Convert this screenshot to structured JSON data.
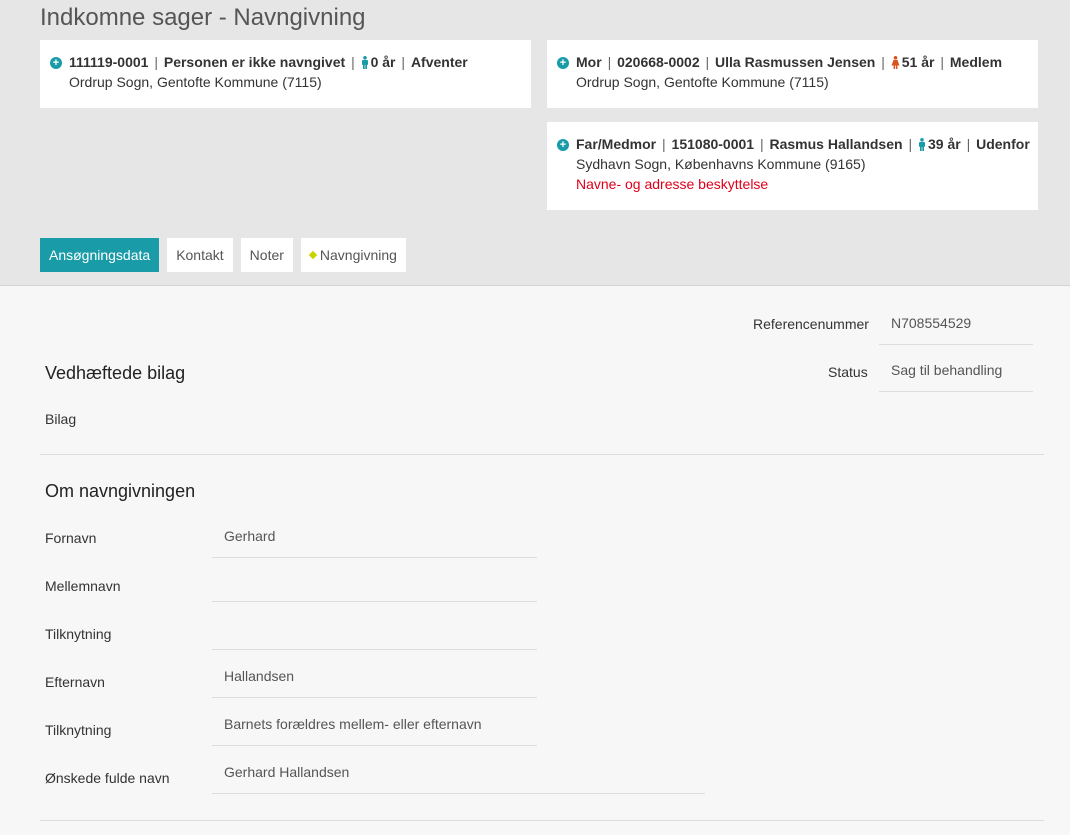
{
  "page_title": "Indkomne sager - Navngivning",
  "cards": {
    "child": {
      "cpr": "111119-0001",
      "name": "Personen er ikke navngivet",
      "age": "0 år",
      "status": "Afventer",
      "parish": "Ordrup Sogn, Gentofte Kommune (7115)"
    },
    "mother": {
      "role": "Mor",
      "cpr": "020668-0002",
      "name": "Ulla Rasmussen Jensen",
      "age": "51 år",
      "status": "Medlem",
      "parish": "Ordrup Sogn, Gentofte Kommune (7115)"
    },
    "father": {
      "role": "Far/Medmor",
      "cpr": "151080-0001",
      "name": "Rasmus Hallandsen",
      "age": "39 år",
      "status": "Udenfor",
      "parish": "Sydhavn Sogn, Københavns Kommune (9165)",
      "warning": "Navne- og adresse beskyttelse"
    },
    "separator": "|"
  },
  "tabs": {
    "application": "Ansøgningsdata",
    "contact": "Kontakt",
    "notes": "Noter",
    "naming": "Navngivning"
  },
  "reference": {
    "label": "Referencenummer",
    "value": "N708554529"
  },
  "status": {
    "label": "Status",
    "value": "Sag til behandling"
  },
  "attachments": {
    "title": "Vedhæftede bilag",
    "label": "Bilag"
  },
  "naming": {
    "title": "Om navngivningen",
    "fields": [
      {
        "label": "Fornavn",
        "value": "Gerhard"
      },
      {
        "label": "Mellemnavn",
        "value": ""
      },
      {
        "label": "Tilknytning",
        "value": ""
      },
      {
        "label": "Efternavn",
        "value": "Hallandsen"
      },
      {
        "label": "Tilknytning",
        "value": "Barnets forældres mellem- eller efternavn"
      },
      {
        "label": "Ønskede fulde navn",
        "value": "Gerhard Hallandsen"
      }
    ]
  },
  "colors": {
    "accent": "#1a9ba8",
    "male": "#1a9ba8",
    "female": "#d9531e",
    "warning": "#e0001b",
    "tab_marker": "#c8d400"
  },
  "icons": {
    "expand": "plus-circle-icon",
    "male": "male-person-icon",
    "female": "female-person-icon"
  }
}
